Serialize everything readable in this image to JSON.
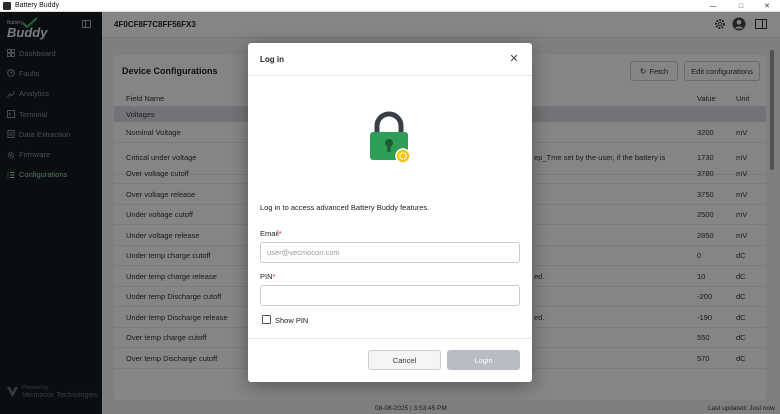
{
  "window": {
    "title": "Battery Buddy"
  },
  "brand": {
    "line1": "Battery",
    "line2": "Buddy"
  },
  "sidebar": {
    "items": [
      {
        "label": "Dashboard",
        "icon": "dashboard-icon"
      },
      {
        "label": "Faults",
        "icon": "clock-icon"
      },
      {
        "label": "Analytics",
        "icon": "analytics-icon"
      },
      {
        "label": "Terminal",
        "icon": "terminal-icon"
      },
      {
        "label": "Data Extraction",
        "icon": "data-extraction-icon"
      },
      {
        "label": "Firmware",
        "icon": "gear-icon"
      },
      {
        "label": "Configurations",
        "icon": "list-icon"
      }
    ],
    "powered_by": "Powered by",
    "company": "Vecmocon Technologies"
  },
  "header": {
    "device_id": "4F0CF8F7C8FF56FX3"
  },
  "config": {
    "title": "Device Configurations",
    "fetch_label": "Fetch",
    "edit_label": "Edit configurations",
    "columns": {
      "field": "Field Name",
      "value": "Value",
      "unit": "Unit"
    },
    "group": "Voltages",
    "rows": [
      {
        "name": "Nominal Voltage",
        "desc": "",
        "value": "3200",
        "unit": "mV"
      },
      {
        "name": "Critical under voltage",
        "desc": "ep_Tme set by the user, if the battery is",
        "value": "1730",
        "unit": "mV"
      },
      {
        "name": "Over voltage cutoff",
        "desc": "",
        "value": "3780",
        "unit": "mV"
      },
      {
        "name": "Over voltage release",
        "desc": "",
        "value": "3750",
        "unit": "mV"
      },
      {
        "name": "Under voltage cutoff",
        "desc": "",
        "value": "2500",
        "unit": "mV"
      },
      {
        "name": "Under voltage release",
        "desc": "",
        "value": "2850",
        "unit": "mV"
      },
      {
        "name": "Under temp charge cutoff",
        "desc": "",
        "value": "0",
        "unit": "dC"
      },
      {
        "name": "Under temp charge release",
        "desc": "ed.",
        "value": "10",
        "unit": "dC"
      },
      {
        "name": "Under temp Discharge cutoff",
        "desc": "",
        "value": "-200",
        "unit": "dC"
      },
      {
        "name": "Under temp Discharge release",
        "desc": "ed.",
        "value": "-190",
        "unit": "dC"
      },
      {
        "name": "Over temp charge cutoff",
        "desc": "",
        "value": "550",
        "unit": "dC"
      },
      {
        "name": "Over temp Discharge cutoff",
        "desc": "",
        "value": "570",
        "unit": "dC"
      }
    ]
  },
  "footer": {
    "timestamp": "08-08-2025 | 3:53:45 PM",
    "last_updated": "Last updated: Just now"
  },
  "modal": {
    "title": "Log in",
    "intro": "Log in to access advanced Battery Buddy features.",
    "email_label": "Email",
    "email_placeholder": "user@vecmocon.com",
    "pin_label": "PIN",
    "required_mark": "*",
    "show_pin_label": "Show PIN",
    "cancel_label": "Cancel",
    "login_label": "Login"
  },
  "colors": {
    "accent_green": "#2e9d57",
    "lock_badge": "#f2c21b",
    "sidebar_bg": "#161b22"
  }
}
